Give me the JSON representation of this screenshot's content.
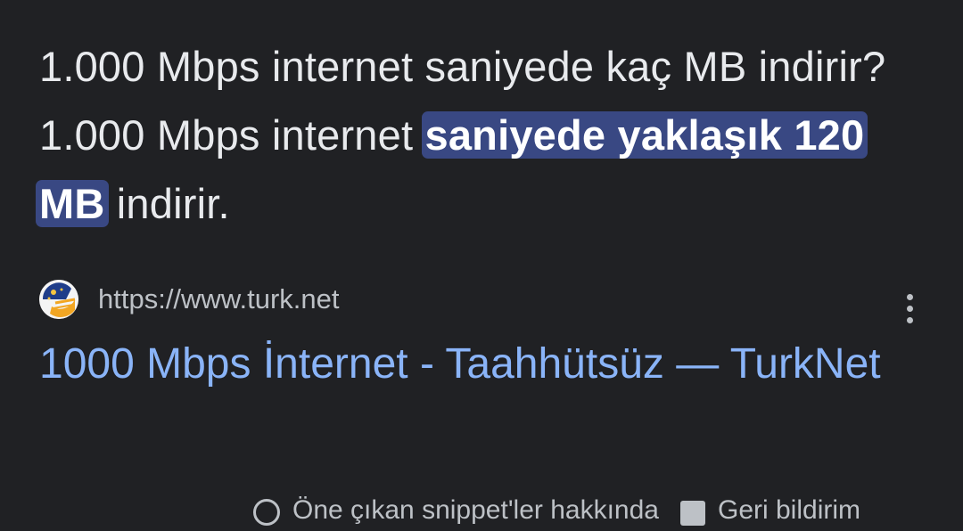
{
  "snippet": {
    "part1": "1.000 Mbps internet saniyede kaç MB indirir? 1.000 Mbps internet ",
    "highlight": "saniyede yaklaşık 120 MB",
    "part2": " indirir."
  },
  "source": {
    "url": "https://www.turk.net",
    "favicon_icon": "turknet-logo-icon"
  },
  "result": {
    "title": "1000 Mbps İnternet - Taahhütsüz — TurkNet"
  },
  "footer": {
    "item1_label": "Öne çıkan snippet'ler hakkında",
    "item2_label": "Geri bildirim"
  },
  "colors": {
    "background": "#202124",
    "highlight_bg": "#394883",
    "link": "#8ab4f8",
    "text": "#e8eaed",
    "muted": "#bdc1c6"
  }
}
